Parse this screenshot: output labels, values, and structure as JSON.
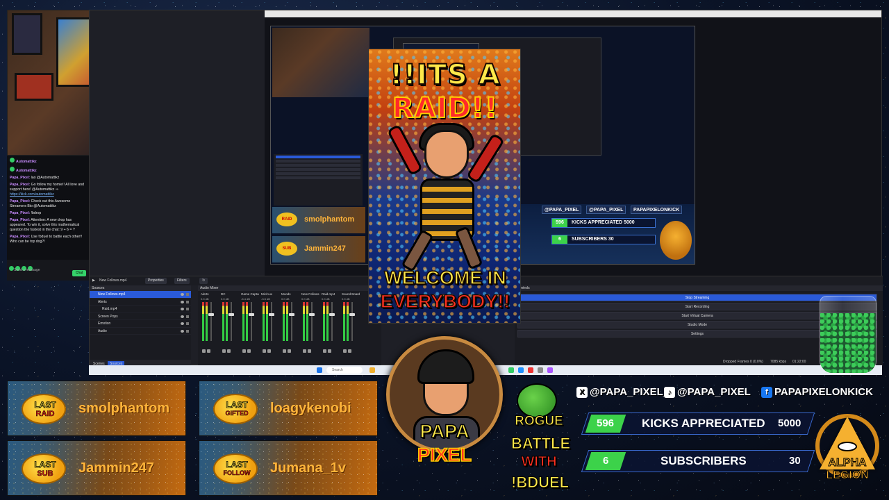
{
  "chat": {
    "lines": [
      {
        "user": "Automattikz",
        "text": ""
      },
      {
        "user": "Automattikz",
        "text": ""
      },
      {
        "user": "Papa_Pixel:",
        "text": " lao @Automattikz"
      },
      {
        "user": "Papa_Pixel:",
        "text": " Go follow my homie!! All love and support here! @Automattikz ⇒ "
      },
      {
        "user": "",
        "text": "https://kick.com/automattikz"
      },
      {
        "user": "Papa_Pixel:",
        "text": " Check out this Awesome Streamers Bio @Automattikz"
      },
      {
        "user": "Papa_Pixel:",
        "text": " !bdrop"
      },
      {
        "user": "Papa_Pixel:",
        "text": " Attention: A new drop has appeared. To win it, solve this mathematical question the fastest in the chat: 9 + 6 = ?"
      },
      {
        "user": "Papa_Pixel:",
        "text": " Use !bduel to battle each other!! Who can be top dog?!"
      }
    ],
    "send_placeholder": "Send a message",
    "chat_button": "Chat"
  },
  "obs": {
    "toolbar_source": "New Follows.mp4",
    "properties": "Properties",
    "filters": "Filters",
    "sources_header": "Sources",
    "mixer_header": "Audio Mixer",
    "controls_header": "Controls",
    "sources": [
      {
        "label": "New Follows.mp4"
      },
      {
        "label": "Alerts"
      },
      {
        "label": "Raid.mp4"
      },
      {
        "label": "Screen Pops"
      },
      {
        "label": "Emotion"
      },
      {
        "label": "Audio"
      }
    ],
    "tab_scenes": "Scenes",
    "tab_sources": "Sources",
    "mixer_channels": [
      {
        "name": "Alerts",
        "db": "0.0 dB"
      },
      {
        "name": "DC",
        "db": "0.0 dB"
      },
      {
        "name": "Game Capture",
        "db": "-5.4 dB"
      },
      {
        "name": "Mic/Aux",
        "db": "-3.5 dB"
      },
      {
        "name": "Moods",
        "db": "0.0 dB"
      },
      {
        "name": "New Follows.mp4",
        "db": "0.0 dB"
      },
      {
        "name": "Raid.mp4",
        "db": "0.0 dB"
      },
      {
        "name": "Sound Board",
        "db": "0.0 dB"
      }
    ],
    "controls": [
      "Stop Streaming",
      "Start Recording",
      "Start Virtual Camera",
      "Studio Mode",
      "Settings"
    ],
    "status": "Dropped Frames 0 (0.0%)",
    "bitrate": "7085 kbps",
    "time": "01:22:00",
    "search": "Search"
  },
  "preview": {
    "last_raid": "smolphantom",
    "last_sub": "Jammin247",
    "social_x": "@PAPA_PIXEL",
    "social_ig": "@PAPA_PIXEL",
    "social_fb": "PAPAPIXELONKICK",
    "stat1_num": "596",
    "stat1_label": "KICKS APPRECIATED",
    "stat1_goal": "5000",
    "stat2_num": "6",
    "stat2_label": "SUBSCRIBERS",
    "stat2_goal": "30",
    "rogue": "ROGUE",
    "battle": "BATTLE WITH !BDUEL",
    "alpha": "ALPHA LEGION"
  },
  "raid": {
    "line1": "!!ITS A",
    "line2": "RAID!!",
    "welcome1": "WELCOME IN",
    "welcome2": "EVERYBODY!!"
  },
  "overlay": {
    "last_raid_top": "LAST",
    "last_raid_bot": "RAID",
    "last_raid_name": "smolphantom",
    "last_gifted_top": "LAST",
    "last_gifted_bot": "GIFTED",
    "last_gifted_name": "loagykenobi",
    "last_sub_top": "LAST",
    "last_sub_bot": "SUB",
    "last_sub_name": "Jammin247",
    "last_follow_top": "LAST",
    "last_follow_bot": "FOLLOW",
    "last_follow_name": "Jumana_1v",
    "papa1": "PAPA",
    "papa2": "PIXEL",
    "rogue": "ROGUE",
    "battle1": "BATTLE",
    "battle2": "WITH",
    "battle3": "!BDUEL",
    "social_x": "@PAPA_PIXEL_",
    "social_ig": "@PAPA_PIXEL",
    "social_fb": "PAPAPIXELONKICK",
    "stat1_num": "596",
    "stat1_label": "KICKS APPRECIATED",
    "stat1_goal": "5000",
    "stat2_num": "6",
    "stat2_label": "SUBSCRIBERS",
    "stat2_goal": "30",
    "alpha1": "ALPHA",
    "alpha2": "LEGION"
  },
  "colors": {
    "accent": "#2a5ad8",
    "kick_green": "#3cd24a",
    "gold": "#ffe94a",
    "raid_red": "#ff2a2a"
  },
  "icons": [
    "x-icon",
    "tiktok-icon",
    "facebook-icon",
    "eye-icon",
    "lock-icon"
  ]
}
